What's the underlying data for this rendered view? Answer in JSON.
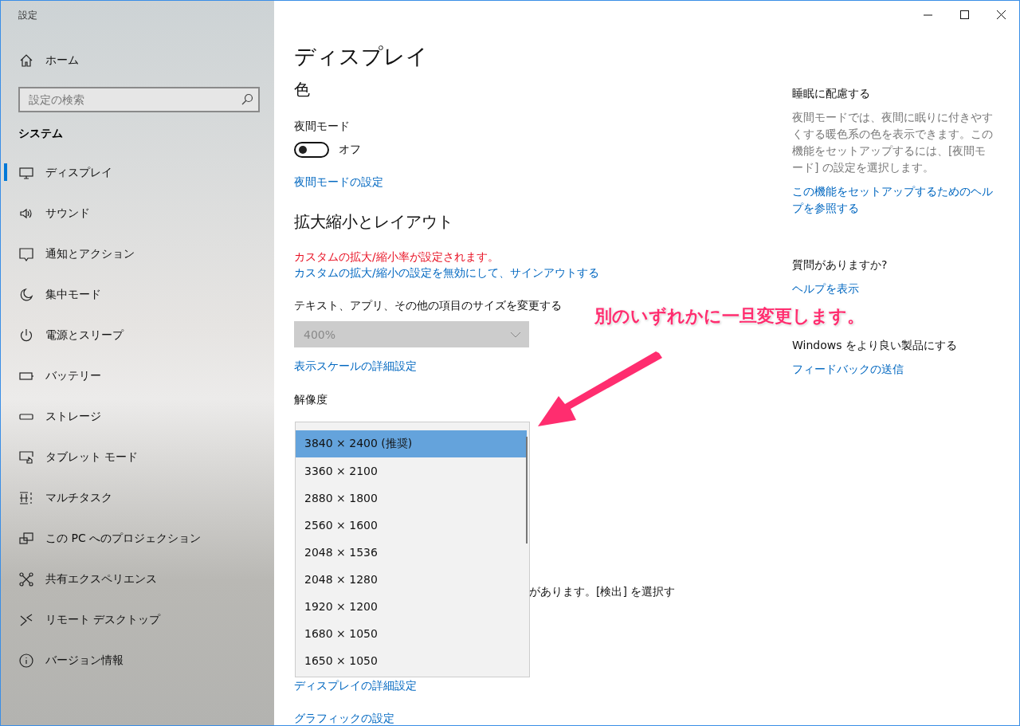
{
  "window": {
    "title": "設定"
  },
  "sidebar": {
    "home": "ホーム",
    "search": {
      "placeholder": "設定の検索"
    },
    "section": "システム",
    "items": [
      {
        "label": "ディスプレイ",
        "selected": true
      },
      {
        "label": "サウンド",
        "selected": false
      },
      {
        "label": "通知とアクション",
        "selected": false
      },
      {
        "label": "集中モード",
        "selected": false
      },
      {
        "label": "電源とスリープ",
        "selected": false
      },
      {
        "label": "バッテリー",
        "selected": false
      },
      {
        "label": "ストレージ",
        "selected": false
      },
      {
        "label": "タブレット モード",
        "selected": false
      },
      {
        "label": "マルチタスク",
        "selected": false
      },
      {
        "label": "この PC へのプロジェクション",
        "selected": false
      },
      {
        "label": "共有エクスペリエンス",
        "selected": false
      },
      {
        "label": "リモート デスクトップ",
        "selected": false
      },
      {
        "label": "バージョン情報",
        "selected": false
      }
    ]
  },
  "main": {
    "title": "ディスプレイ",
    "color_heading": "色",
    "night_mode": {
      "label": "夜間モード",
      "on": false,
      "state_text": "オフ"
    },
    "night_link": "夜間モードの設定",
    "scale_heading": "拡大縮小とレイアウト",
    "warning": "カスタムの拡大/縮小率が設定されます。",
    "warning_link": "カスタムの拡大/縮小の設定を無効にして、サインアウトする",
    "size_label": "テキスト、アプリ、その他の項目のサイズを変更する",
    "size_dropdown": {
      "value": "400%",
      "disabled": true
    },
    "scale_link": "表示スケールの詳細設定",
    "resolution_label": "解像度",
    "resolution_options": [
      {
        "label": "3840 × 2400 (推奨)",
        "selected": true
      },
      {
        "label": "3360 × 2100",
        "selected": false
      },
      {
        "label": "2880 × 1800",
        "selected": false
      },
      {
        "label": "2560 × 1600",
        "selected": false
      },
      {
        "label": "2048 × 1536",
        "selected": false
      },
      {
        "label": "2048 × 1280",
        "selected": false
      },
      {
        "label": "1920 × 1200",
        "selected": false
      },
      {
        "label": "1680 × 1050",
        "selected": false
      },
      {
        "label": "1650 × 1050",
        "selected": false
      }
    ],
    "hidden_text_tail": "があります。[検出] を選択す",
    "advanced_link": "ディスプレイの詳細設定",
    "graphics_link": "グラフィックの設定"
  },
  "side_info": {
    "sections": [
      {
        "heading": "睡眠に配慮する",
        "body": "夜間モードでは、夜間に眠りに付きやすくする暖色系の色を表示できます。この機能をセットアップするには、[夜間モード] の設定を選択します。",
        "link": "この機能をセットアップするためのヘルプを参照する"
      },
      {
        "heading": "質問がありますか?",
        "link": "ヘルプを表示"
      },
      {
        "heading": "Windows をより良い製品にする",
        "link": "フィードバックの送信"
      }
    ]
  },
  "annotation": {
    "text": "別のいずれかに一旦変更します。"
  }
}
